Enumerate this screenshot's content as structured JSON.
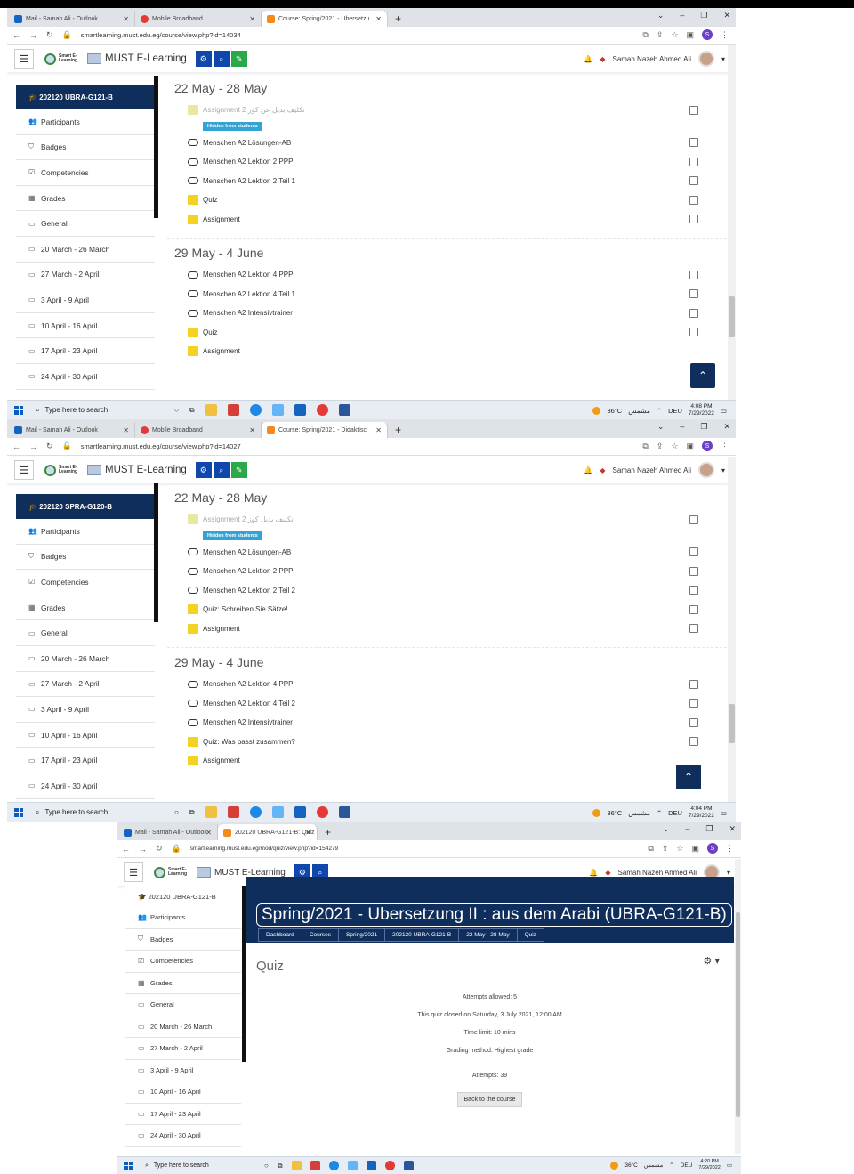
{
  "screens": [
    {
      "tabs": [
        "Mail - Samah Ali - Outlook",
        "Mobile Broadband",
        "Course: Spring/2021 - Ubersetzu"
      ],
      "url": "smartlearning.must.edu.eg/course/view.php?id=14034",
      "brand": "MUST E-Learning",
      "logo_text": "Smart E-Learning",
      "user": "Samah Nazeh Ahmed Ali",
      "course": "202120 UBRA-G121-B",
      "sidebar": [
        "Participants",
        "Badges",
        "Competencies",
        "Grades",
        "General",
        "20 March - 26 March",
        "27 March - 2 April",
        "3 April - 9 April",
        "10 April - 16 April",
        "17 April - 23 April",
        "24 April - 30 April"
      ],
      "sections": [
        {
          "title": "22 May - 28 May",
          "activities": [
            {
              "label": "Assignment 2 تكليف بديل عن كوز",
              "type": "doc",
              "dim": true,
              "badge": "Hidden from students"
            },
            {
              "label": "Menschen A2 Lösungen-AB",
              "type": "link"
            },
            {
              "label": "Menschen A2 Lektion 2 PPP",
              "type": "link"
            },
            {
              "label": "Menschen A2 Lektion 2 Teil 1",
              "type": "link"
            },
            {
              "label": "Quiz",
              "type": "doc"
            },
            {
              "label": "Assignment",
              "type": "doc"
            }
          ]
        },
        {
          "title": "29 May - 4 June",
          "activities": [
            {
              "label": "Menschen A2 Lektion 4 PPP",
              "type": "link"
            },
            {
              "label": "Menschen A2 Lektion 4 Teil 1",
              "type": "link"
            },
            {
              "label": "Menschen A2 Intensivtrainer",
              "type": "link"
            },
            {
              "label": "Quiz",
              "type": "doc"
            },
            {
              "label": "Assignment",
              "type": "doc"
            }
          ]
        }
      ],
      "taskbar": {
        "search": "Type here to search",
        "temp": "36°C",
        "weather": "مشمس",
        "lang": "DEU",
        "time": "4:08 PM",
        "date": "7/29/2022"
      }
    },
    {
      "tabs": [
        "Mail - Samah Ali - Outlook",
        "Mobile Broadband",
        "Course: Spring/2021 - Didaktisc"
      ],
      "url": "smartlearning.must.edu.eg/course/view.php?id=14027",
      "brand": "MUST E-Learning",
      "logo_text": "Smart E-Learning",
      "user": "Samah Nazeh Ahmed Ali",
      "course": "202120 SPRA-G120-B",
      "sidebar": [
        "Participants",
        "Badges",
        "Competencies",
        "Grades",
        "General",
        "20 March - 26 March",
        "27 March - 2 April",
        "3 April - 9 April",
        "10 April - 16 April",
        "17 April - 23 April",
        "24 April - 30 April"
      ],
      "sections": [
        {
          "title": "22 May - 28 May",
          "activities": [
            {
              "label": "Assignment 2 تكليف بديل كوز",
              "type": "doc",
              "dim": true,
              "badge": "Hidden from students"
            },
            {
              "label": "Menschen A2 Lösungen-AB",
              "type": "link"
            },
            {
              "label": "Menschen A2 Lektion 2 PPP",
              "type": "link"
            },
            {
              "label": "Menschen A2 Lektion 2 Teil 2",
              "type": "link"
            },
            {
              "label": "Quiz: Schreiben Sie Sätze!",
              "type": "doc"
            },
            {
              "label": "Assignment",
              "type": "doc"
            }
          ]
        },
        {
          "title": "29 May - 4 June",
          "activities": [
            {
              "label": "Menschen A2 Lektion 4 PPP",
              "type": "link"
            },
            {
              "label": "Menschen A2 Lektion 4 Teil 2",
              "type": "link"
            },
            {
              "label": "Menschen A2 Intensivtrainer",
              "type": "link"
            },
            {
              "label": "Quiz: Was passt zusammen?",
              "type": "doc"
            },
            {
              "label": "Assignment",
              "type": "doc"
            }
          ]
        }
      ],
      "taskbar": {
        "search": "Type here to search",
        "temp": "36°C",
        "weather": "مشمس",
        "lang": "DEU",
        "time": "4:04 PM",
        "date": "7/29/2022"
      }
    }
  ],
  "quiz_screen": {
    "tabs": [
      "Mail - Samah Ali - Outlook",
      "202120 UBRA-G121-B: Quiz"
    ],
    "url": "smartlearning.must.edu.eg/mod/quiz/view.php?id=154279",
    "brand": "MUST E-Learning",
    "user": "Samah Nazeh Ahmed Ali",
    "course": "202120 UBRA-G121-B",
    "sidebar": [
      "Participants",
      "Badges",
      "Competencies",
      "Grades",
      "General",
      "20 March - 26 March",
      "27 March - 2 April",
      "3 April - 9 April",
      "10 April - 16 April",
      "17 April - 23 April",
      "24 April - 30 April"
    ],
    "page_title": "Spring/2021 - Ubersetzung II : aus dem Arabi (UBRA-G121-B)",
    "breadcrumbs": [
      "Dashboard",
      "Courses",
      "Spring/2021",
      "202120 UBRA-G121-B",
      "22 May - 28 May",
      "Quiz"
    ],
    "heading": "Quiz",
    "info": [
      "Attempts allowed: 5",
      "This quiz closed on Saturday, 3 July 2021, 12:00 AM",
      "Time limit: 10 mins",
      "Grading method: Highest grade",
      "Attempts: 39"
    ],
    "back_button": "Back to the course",
    "taskbar": {
      "search": "Type here to search",
      "temp": "36°C",
      "weather": "مشمس",
      "lang": "DEU",
      "time": "4:20 PM",
      "date": "7/29/2022"
    }
  },
  "colors": {
    "navy": "#0f2e5c",
    "blue": "#0f47ad",
    "green": "#2aa84a",
    "badge": "#33a3d6",
    "quiz_icon": "#f4d221"
  }
}
